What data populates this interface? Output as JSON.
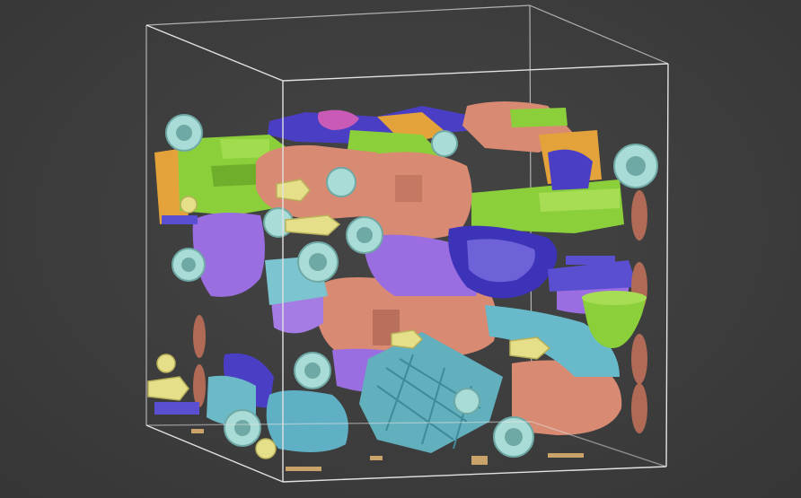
{
  "scene": {
    "background_color": "#3b3b3b",
    "bounding_box_color": "#d8d8d8",
    "palette": {
      "salmon": "#d98a72",
      "purple": "#9a6ee0",
      "cyan": "#7cc4cf",
      "teal_light": "#a9dcd6",
      "green": "#8bcf3a",
      "orange": "#e4a23b",
      "blue": "#4a3fc4",
      "yellow": "#e6df8a",
      "magenta": "#c95bb6",
      "brown": "#b06a55"
    }
  }
}
